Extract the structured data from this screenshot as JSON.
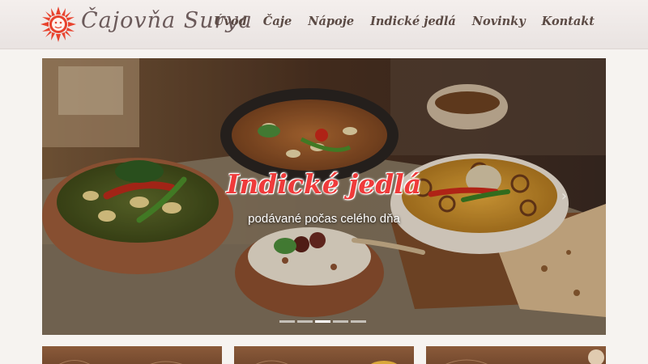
{
  "brand": {
    "name": "Čajovňa Surya"
  },
  "nav": [
    {
      "label": "Úvod"
    },
    {
      "label": "Čaje"
    },
    {
      "label": "Nápoje"
    },
    {
      "label": "Indické jedlá"
    },
    {
      "label": "Novinky"
    },
    {
      "label": "Kontakt"
    }
  ],
  "hero": {
    "title": "Indické jedlá",
    "subtitle": "podávané počas celého dňa",
    "next_arrow": "›",
    "slides_total": 5,
    "active_slide": 3
  },
  "colors": {
    "accent_red": "#ef3b3b",
    "nav_text": "#5b4a44",
    "logo_red": "#e8432e"
  },
  "icons": {
    "logo": "sun-face-icon",
    "next": "chevron-right-icon"
  }
}
